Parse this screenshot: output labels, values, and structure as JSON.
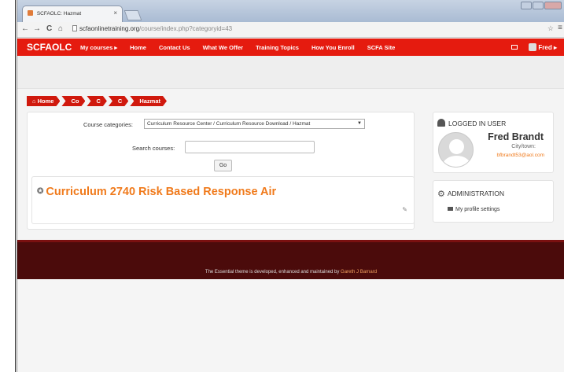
{
  "tab": {
    "title": "SCFAOLC: Hazmat",
    "close": "×"
  },
  "address": {
    "domain": "scfaonlinetraining.org",
    "path": "/course/index.php?categoryid=43"
  },
  "nav_controls": {
    "back": "←",
    "forward": "→",
    "reload": "C",
    "home": "⌂",
    "star": "☆",
    "menu": "≡"
  },
  "site_nav": {
    "brand": "SCFAOLC",
    "items": [
      "My courses ▸",
      "Home",
      "Contact Us",
      "What We Offer",
      "Training Topics",
      "How You Enroll",
      "SCFA Site"
    ],
    "user": "Fred ▸"
  },
  "breadcrumb": [
    "Home",
    "Co",
    "C",
    "C",
    "Hazmat"
  ],
  "course_search": {
    "categories_label": "Course categories:",
    "categories_value": "Curriculum Resource Center / Curriculum Resource Download / Hazmat",
    "search_label": "Search courses:",
    "go_label": "Go"
  },
  "course": {
    "title": "Curriculum 2740 Risk Based Response Air"
  },
  "logged_in_block": {
    "title": "LOGGED IN USER",
    "name": "Fred Brandt",
    "city": "City/town:",
    "email": "bfbrandt53@aol.com"
  },
  "admin_block": {
    "title": "ADMINISTRATION",
    "link": "My profile settings"
  },
  "footer": {
    "text": "The Essential theme is developed, enhanced and maintained by ",
    "author": "Gareth J Barnard"
  },
  "colors": {
    "nav_red": "#e51b0f",
    "accent_orange": "#f07a1b",
    "footer_dark": "#4b0b0b"
  }
}
